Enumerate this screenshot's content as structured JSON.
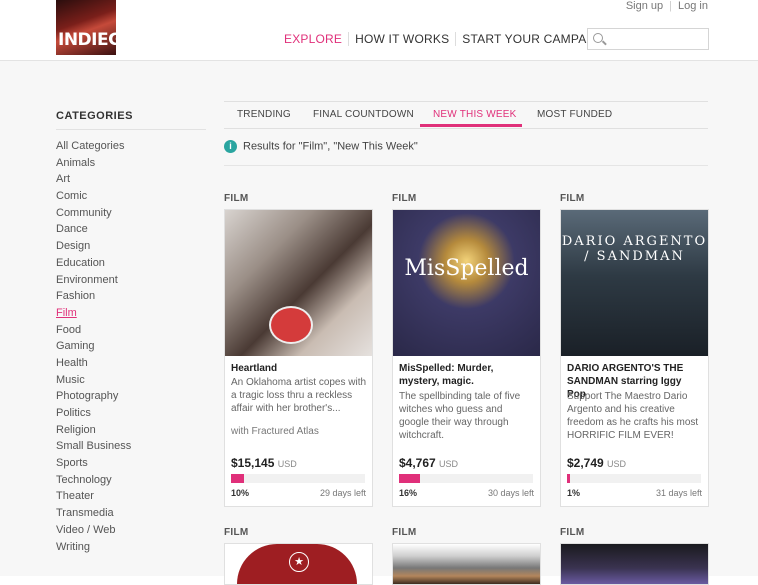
{
  "header": {
    "logo_text": "INDIEGOGO",
    "signup": "Sign up",
    "login": "Log in",
    "nav": [
      "EXPLORE",
      "HOW IT WORKS",
      "START YOUR CAMPAIGN"
    ],
    "search_placeholder": ""
  },
  "sidebar": {
    "title": "CATEGORIES",
    "items": [
      "All Categories",
      "Animals",
      "Art",
      "Comic",
      "Community",
      "Dance",
      "Design",
      "Education",
      "Environment",
      "Fashion",
      "Film",
      "Food",
      "Gaming",
      "Health",
      "Music",
      "Photography",
      "Politics",
      "Religion",
      "Small Business",
      "Sports",
      "Technology",
      "Theater",
      "Transmedia",
      "Video / Web",
      "Writing"
    ],
    "active": "Film"
  },
  "tabs": [
    "TRENDING",
    "FINAL COUNTDOWN",
    "NEW THIS WEEK",
    "MOST FUNDED"
  ],
  "active_tab": "NEW THIS WEEK",
  "results_text": "Results for \"Film\", \"New This Week\"",
  "cards": [
    {
      "category": "FILM",
      "title": "Heartland",
      "desc": "An Oklahoma artist copes with a tragic loss thru a reckless affair with her brother's...",
      "partner": "with Fractured Atlas",
      "amount": "$15,145",
      "currency": "USD",
      "percent_label": "10%",
      "progress": 0.1,
      "days": "29 days left",
      "image_caption": ""
    },
    {
      "category": "FILM",
      "title": "MisSpelled: Murder, mystery, magic.",
      "desc": "The spellbinding tale of five witches who guess and google their way through witchcraft.",
      "partner": "",
      "amount": "$4,767",
      "currency": "USD",
      "percent_label": "16%",
      "progress": 0.16,
      "days": "30 days left",
      "image_caption": "MisSpelled"
    },
    {
      "category": "FILM",
      "title": "DARIO ARGENTO'S THE SANDMAN starring Iggy Pop",
      "desc": "Support The Maestro Dario Argento and his creative freedom as he crafts his most HORRIFIC FILM EVER!",
      "partner": "",
      "amount": "$2,749",
      "currency": "USD",
      "percent_label": "1%",
      "progress": 0.01,
      "days": "31 days left",
      "image_caption": "DARIO ARGENTO / SANDMAN"
    }
  ],
  "bottom_labels": [
    "FILM",
    "FILM",
    "FILM"
  ],
  "accent": "#e0307a"
}
